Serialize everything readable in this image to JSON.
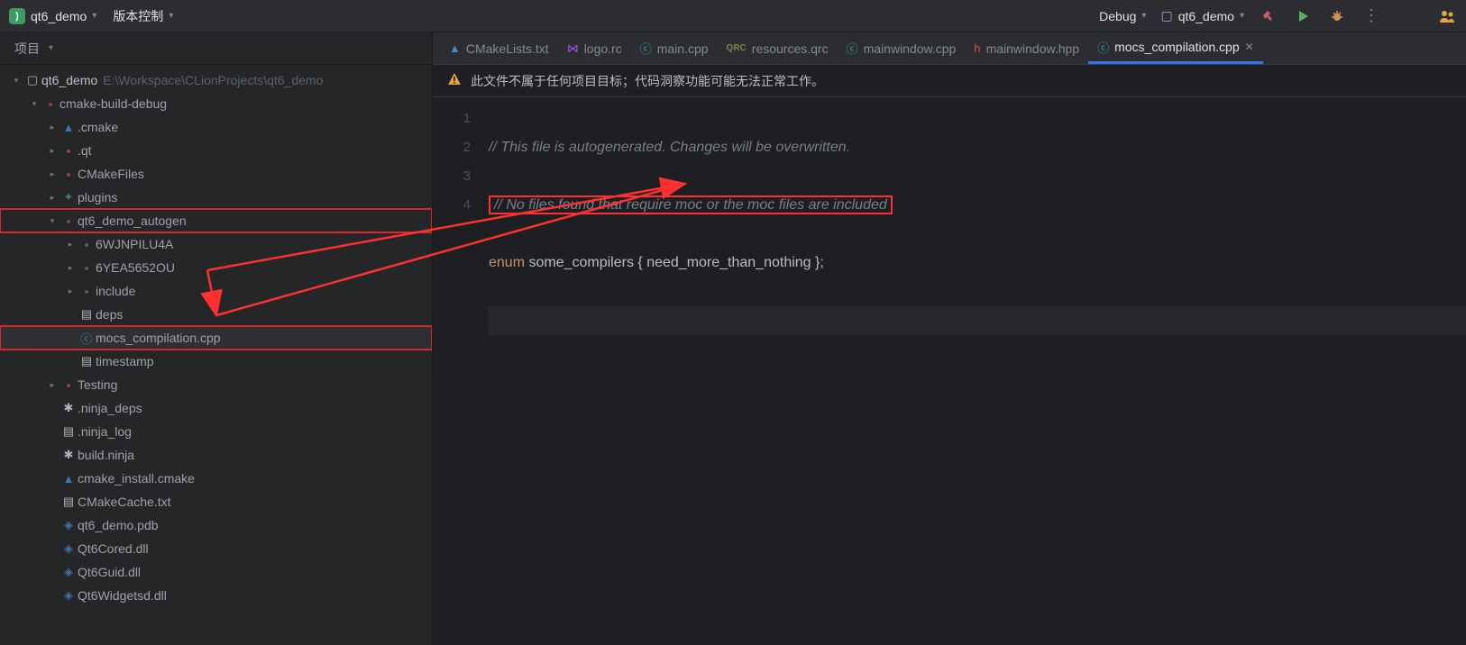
{
  "topbar": {
    "project": "qt6_demo",
    "vcs": "版本控制",
    "debug": "Debug",
    "target": "qt6_demo"
  },
  "sidebar": {
    "title": "项目",
    "root_label": "qt6_demo",
    "root_path": "E:\\Workspace\\CLionProjects\\qt6_demo",
    "tree": [
      {
        "indent": 1,
        "arrow": "v",
        "icon": "folder-red",
        "label": "cmake-build-debug"
      },
      {
        "indent": 2,
        "arrow": ">",
        "icon": "cmake",
        "label": ".cmake"
      },
      {
        "indent": 2,
        "arrow": ">",
        "icon": "folder-red",
        "label": ".qt"
      },
      {
        "indent": 2,
        "arrow": ">",
        "icon": "folder-red",
        "label": "CMakeFiles"
      },
      {
        "indent": 2,
        "arrow": ">",
        "icon": "puzzle",
        "label": "plugins"
      },
      {
        "indent": 2,
        "arrow": "v",
        "icon": "folder-red",
        "label": "qt6_demo_autogen",
        "red": true
      },
      {
        "indent": 3,
        "arrow": ">",
        "icon": "folder-red",
        "label": "6WJNPILU4A"
      },
      {
        "indent": 3,
        "arrow": ">",
        "icon": "folder-red",
        "label": "6YEA5652OU"
      },
      {
        "indent": 3,
        "arrow": ">",
        "icon": "folder-spec",
        "label": "include"
      },
      {
        "indent": 3,
        "arrow": "",
        "icon": "file",
        "label": "deps"
      },
      {
        "indent": 3,
        "arrow": "",
        "icon": "cpp",
        "label": "mocs_compilation.cpp",
        "selected": true,
        "red": true
      },
      {
        "indent": 3,
        "arrow": "",
        "icon": "file",
        "label": "timestamp"
      },
      {
        "indent": 2,
        "arrow": ">",
        "icon": "folder-red",
        "label": "Testing"
      },
      {
        "indent": 2,
        "arrow": "",
        "icon": "ninja",
        "label": ".ninja_deps"
      },
      {
        "indent": 2,
        "arrow": "",
        "icon": "file",
        "label": ".ninja_log"
      },
      {
        "indent": 2,
        "arrow": "",
        "icon": "ninja",
        "label": "build.ninja"
      },
      {
        "indent": 2,
        "arrow": "",
        "icon": "cmake",
        "label": "cmake_install.cmake"
      },
      {
        "indent": 2,
        "arrow": "",
        "icon": "file",
        "label": "CMakeCache.txt"
      },
      {
        "indent": 2,
        "arrow": "",
        "icon": "cube",
        "label": "qt6_demo.pdb"
      },
      {
        "indent": 2,
        "arrow": "",
        "icon": "cube",
        "label": "Qt6Cored.dll"
      },
      {
        "indent": 2,
        "arrow": "",
        "icon": "cube",
        "label": "Qt6Guid.dll"
      },
      {
        "indent": 2,
        "arrow": "",
        "icon": "cube",
        "label": "Qt6Widgetsd.dll"
      }
    ]
  },
  "tabs": [
    {
      "icon": "cmk",
      "label": "CMakeLists.txt"
    },
    {
      "icon": "vs",
      "label": "logo.rc"
    },
    {
      "icon": "c",
      "label": "main.cpp"
    },
    {
      "icon": "qrc",
      "label": "resources.qrc"
    },
    {
      "icon": "c",
      "label": "mainwindow.cpp"
    },
    {
      "icon": "h",
      "label": "mainwindow.hpp"
    },
    {
      "icon": "c",
      "label": "mocs_compilation.cpp",
      "active": true
    }
  ],
  "warn": "此文件不属于任何项目目标；代码洞察功能可能无法正常工作。",
  "code": {
    "line1": "// This file is autogenerated. Changes will be overwritten.",
    "line2": "// No files found that require moc or the moc files are included",
    "line3_kw": "enum",
    "line3_rest": " some_compilers { need_more_than_nothing };"
  },
  "gutter": [
    "1",
    "2",
    "3",
    "4"
  ]
}
